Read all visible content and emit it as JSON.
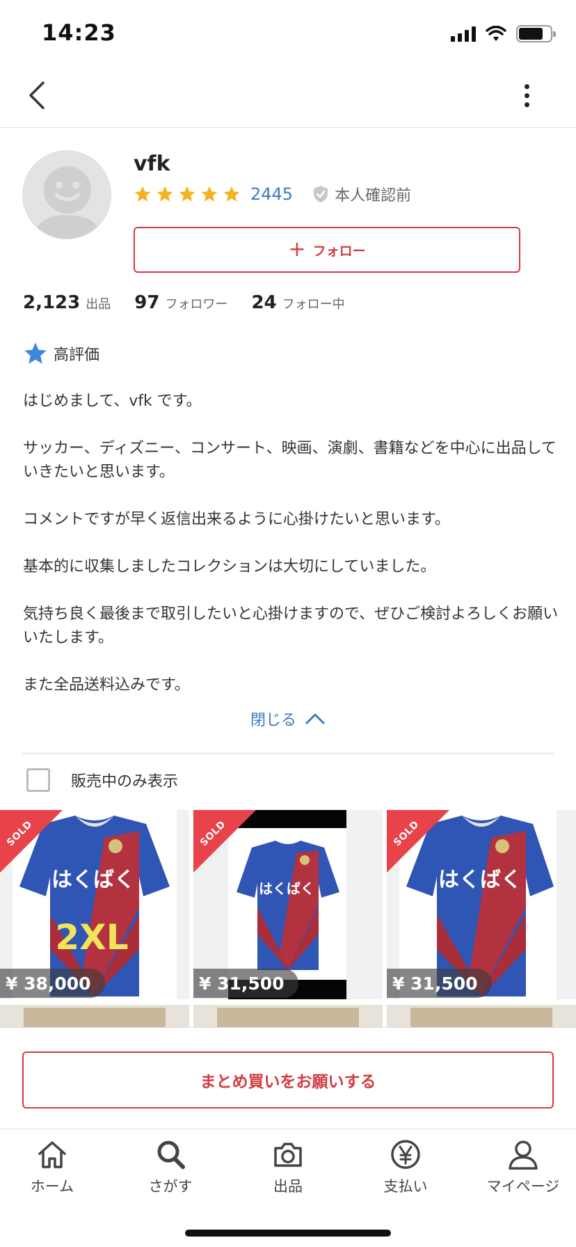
{
  "status_bar": {
    "time": "14:23"
  },
  "profile": {
    "username": "vfk",
    "rating_stars": 5,
    "rating_count": "2445",
    "verification_status": "本人確認前",
    "follow_label": "フォロー"
  },
  "stats": [
    {
      "value": "2,123",
      "label": "出品"
    },
    {
      "value": "97",
      "label": "フォロワー"
    },
    {
      "value": "24",
      "label": "フォロー中"
    }
  ],
  "badge": {
    "label": "高評価"
  },
  "bio": [
    "はじめまして、vfk です。",
    "サッカー、ディズニー、コンサート、映画、演劇、書籍などを中心に出品していきたいと思います。",
    "コメントですが早く返信出来るように心掛けたいと思います。",
    "基本的に収集しましたコレクションは大切にしていました。",
    "気持ち良く最後まで取引したいと心掛けますので、ぜひご検討よろしくお願いいたします。",
    "また全品送料込みです。"
  ],
  "close_label": "閉じる",
  "filter": {
    "label": "販売中のみ表示",
    "checked": false
  },
  "items": [
    {
      "status": "SOLD",
      "price": "¥ 38,000",
      "overlay_text": "2XL",
      "sponsor_text": "はくばく"
    },
    {
      "status": "SOLD",
      "price": "¥ 31,500",
      "sponsor_text": "はくばく"
    },
    {
      "status": "SOLD",
      "price": "¥ 31,500",
      "sponsor_text": "はくばく"
    }
  ],
  "bulk_buy_label": "まとめ買いをお願いする",
  "tabs": [
    {
      "label": "ホーム",
      "icon": "home-icon"
    },
    {
      "label": "さがす",
      "icon": "search-icon"
    },
    {
      "label": "出品",
      "icon": "camera-icon"
    },
    {
      "label": "支払い",
      "icon": "yen-icon"
    },
    {
      "label": "マイページ",
      "icon": "person-icon"
    }
  ],
  "colors": {
    "accent": "#d33b42",
    "link": "#3a7cc2",
    "star": "#f5b31f",
    "sold_ribbon": "#e8424a"
  }
}
